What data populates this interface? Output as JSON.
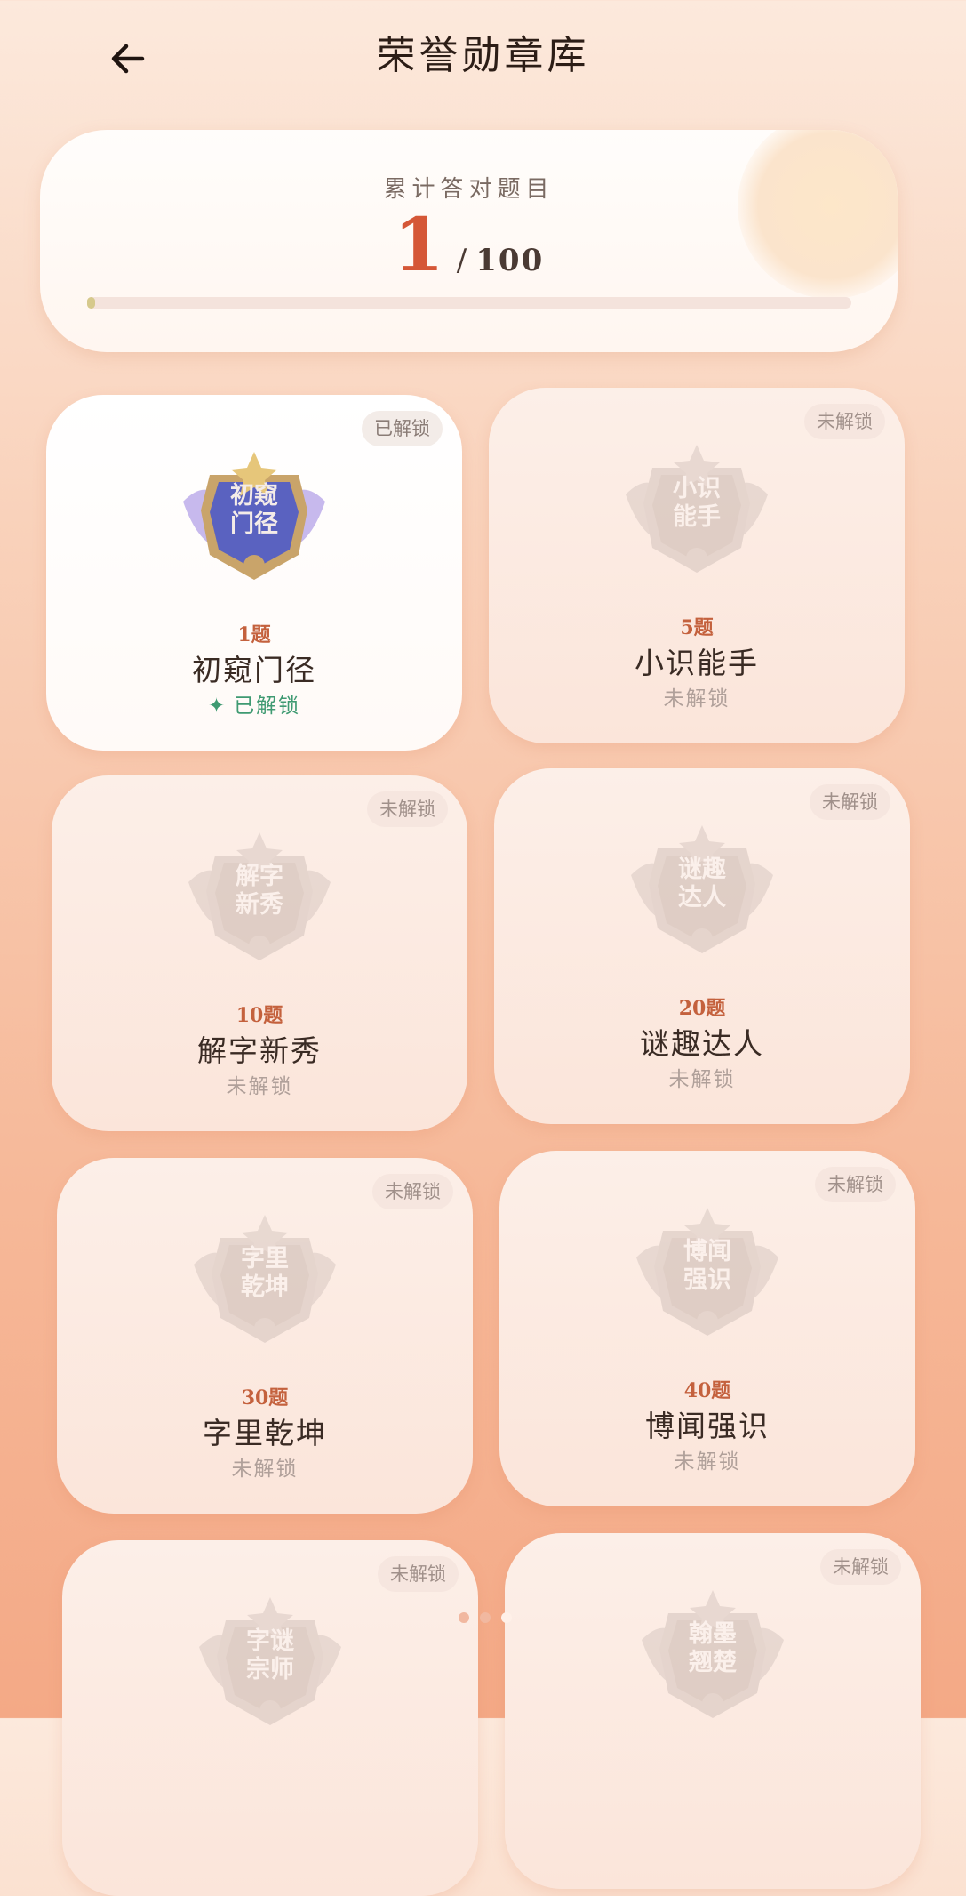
{
  "header": {
    "title": "荣誉勋章库"
  },
  "summary": {
    "label": "累计答对题目",
    "current": "1",
    "separator": "/",
    "total": "100",
    "progress_fraction": 0.01
  },
  "badges": [
    {
      "medal_text_1": "初窥",
      "medal_text_2": "门径",
      "requirement": "1题",
      "name": "初窥门径",
      "tag": "已解锁",
      "status": "已解锁",
      "unlocked": true
    },
    {
      "medal_text_1": "小识",
      "medal_text_2": "能手",
      "requirement": "5题",
      "name": "小识能手",
      "tag": "未解锁",
      "status": "未解锁",
      "unlocked": false
    },
    {
      "medal_text_1": "解字",
      "medal_text_2": "新秀",
      "requirement": "10题",
      "name": "解字新秀",
      "tag": "未解锁",
      "status": "未解锁",
      "unlocked": false
    },
    {
      "medal_text_1": "谜趣",
      "medal_text_2": "达人",
      "requirement": "20题",
      "name": "谜趣达人",
      "tag": "未解锁",
      "status": "未解锁",
      "unlocked": false
    },
    {
      "medal_text_1": "字里",
      "medal_text_2": "乾坤",
      "requirement": "30题",
      "name": "字里乾坤",
      "tag": "未解锁",
      "status": "未解锁",
      "unlocked": false
    },
    {
      "medal_text_1": "博闻",
      "medal_text_2": "强识",
      "requirement": "40题",
      "name": "博闻强识",
      "tag": "未解锁",
      "status": "未解锁",
      "unlocked": false
    },
    {
      "medal_text_1": "字谜",
      "medal_text_2": "宗师",
      "tag": "未解锁",
      "unlocked": false
    },
    {
      "medal_text_1": "翰墨",
      "medal_text_2": "翘楚",
      "tag": "未解锁",
      "unlocked": false
    }
  ],
  "colors": {
    "accent": "#d55737",
    "unlocked_green": "#3f9a72",
    "requirement": "#c4613d"
  },
  "icons": {
    "back": "arrow-left-icon",
    "medal": "medal-icon",
    "unlocked_mark": "sparkle-icon"
  }
}
